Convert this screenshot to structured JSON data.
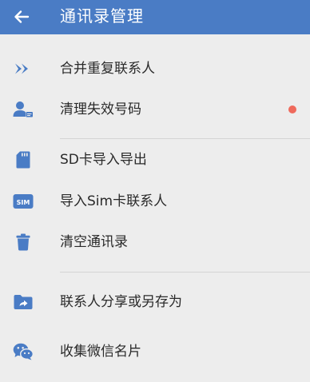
{
  "app_bar": {
    "title": "通讯录管理",
    "back_icon": "arrow-left-icon",
    "color": "#4a7cc5"
  },
  "menu": {
    "accent_color": "#4a7cc5",
    "badge_color": "#ef6a5c",
    "items": [
      {
        "label": "合并重复联系人",
        "icon": "merge-arrows-icon"
      },
      {
        "label": "清理失效号码",
        "icon": "contact-card-icon",
        "has_badge": true
      },
      {
        "label": "SD卡导入导出",
        "icon": "sd-card-icon"
      },
      {
        "label": "导入Sim卡联系人",
        "icon": "sim-card-icon",
        "icon_text": "SIM"
      },
      {
        "label": "清空通讯录",
        "icon": "trash-icon"
      },
      {
        "label": "联系人分享或另存为",
        "icon": "folder-share-icon"
      },
      {
        "label": "收集微信名片",
        "icon": "wechat-icon"
      }
    ]
  }
}
